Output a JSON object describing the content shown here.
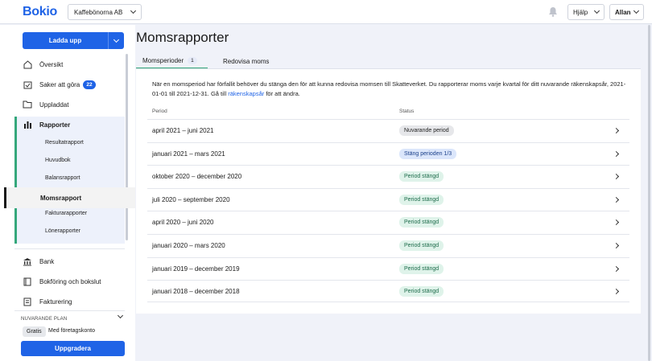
{
  "brand": "Bokio",
  "company": "Kaffebönorna AB",
  "topbar": {
    "help_label": "Hjälp",
    "user_label": "Allan"
  },
  "sidebar": {
    "upload_label": "Ladda upp",
    "items": {
      "overview": "Översikt",
      "todo": "Saker att göra",
      "todo_count": "22",
      "uploaded": "Uppladdat",
      "reports": "Rapporter",
      "bank": "Bank",
      "bookkeeping": "Bokföring och bokslut",
      "invoicing": "Fakturering"
    },
    "report_subitems": [
      "Resultatrapport",
      "Huvudbok",
      "Balansrapport",
      "Momsrapport",
      "Fakturarapporter",
      "Lönerapporter"
    ],
    "plan_label": "NUVARANDE PLAN",
    "plan_badge": "Gratis",
    "plan_text": "Med företagskonto",
    "upgrade_label": "Uppgradera"
  },
  "main": {
    "title": "Momsrapporter",
    "tabs": [
      {
        "label": "Momsperioder",
        "count": "1"
      },
      {
        "label": "Redovisa moms"
      }
    ],
    "intro_text": "När en momsperiod har förfallit behöver du stänga den för att kunna redovisa momsen till Skatteverket. Du rapporterar moms varje kvartal för ditt nuvarande räkenskapsår, 2021-01-01 till 2021-12-31. Gå till ",
    "intro_link": "räkenskapsår",
    "intro_suffix": " för att ändra.",
    "table": {
      "headers": {
        "period": "Period",
        "status": "Status"
      },
      "rows": [
        {
          "period": "april 2021 – juni 2021",
          "status": "Nuvarande period",
          "kind": "grey"
        },
        {
          "period": "januari 2021 – mars 2021",
          "status": "Stäng perioden 1/3",
          "kind": "blue"
        },
        {
          "period": "oktober 2020 – december 2020",
          "status": "Period stängd",
          "kind": "green"
        },
        {
          "period": "juli 2020 – september 2020",
          "status": "Period stängd",
          "kind": "green"
        },
        {
          "period": "april 2020 – juni 2020",
          "status": "Period stängd",
          "kind": "green"
        },
        {
          "period": "januari 2020 – mars 2020",
          "status": "Period stängd",
          "kind": "green"
        },
        {
          "period": "januari 2019 – december 2019",
          "status": "Period stängd",
          "kind": "green"
        },
        {
          "period": "januari 2018 – december 2018",
          "status": "Period stängd",
          "kind": "green"
        }
      ]
    }
  },
  "colors": {
    "primary": "#1f63e6",
    "accent": "#34a77b",
    "background": "#f0f2f9"
  }
}
